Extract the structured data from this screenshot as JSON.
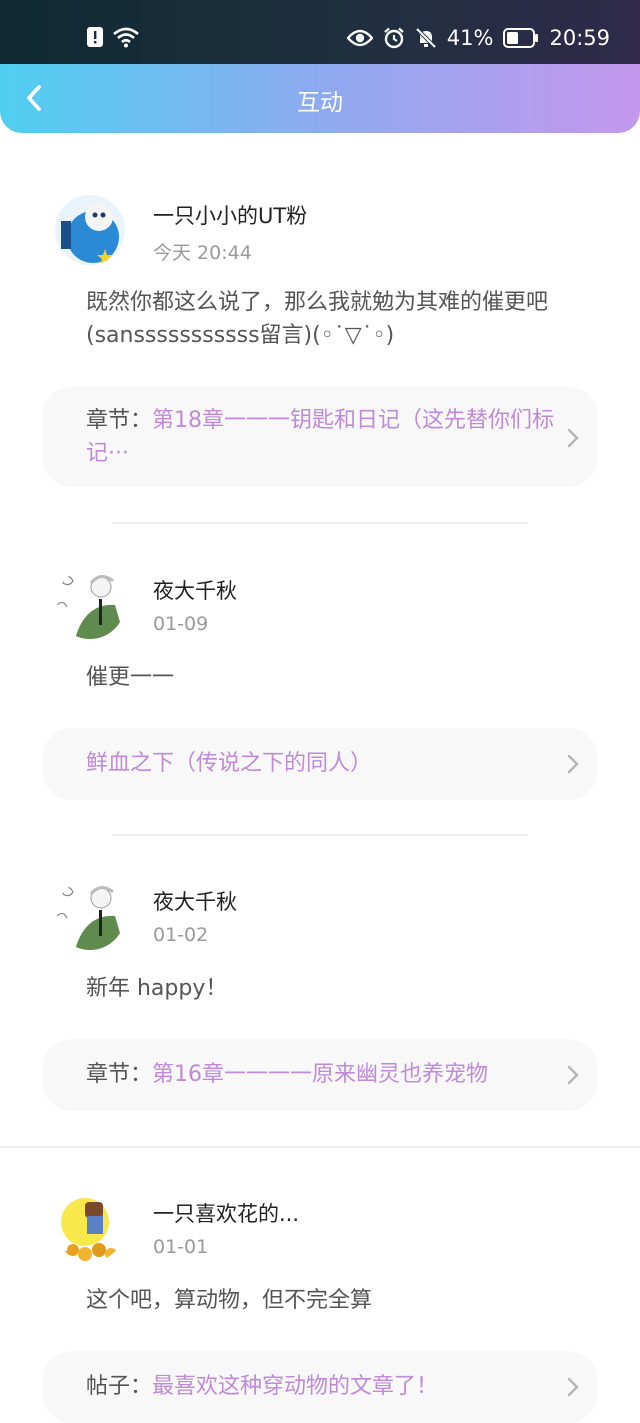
{
  "status_bar": {
    "battery_percent": "41%",
    "time": "20:59",
    "icons": [
      "alert-icon",
      "wifi-icon",
      "eye-icon",
      "alarm-icon",
      "mute-icon",
      "battery-icon"
    ]
  },
  "header": {
    "title": "互动",
    "back_icon": "chevron-left-icon"
  },
  "colors": {
    "link": "#c08ad8",
    "header_start": "#4fcff0",
    "header_end": "#c497ec"
  },
  "comments": [
    {
      "user": "一只小小的UT粉",
      "time": "今天 20:44",
      "message": "既然你都这么说了，那么我就勉为其难的催更吧(sansssssssssss留言)(◦˙▽˙◦)",
      "ref_prefix": "章节：",
      "ref_title": "第18章一一一钥匙和日记（这先替你们标记···"
    },
    {
      "user": "夜大千秋",
      "time": "01-09",
      "message": "催更一一",
      "ref_prefix": "",
      "ref_title": "鲜血之下（传说之下的同人）"
    },
    {
      "user": "夜大千秋",
      "time": "01-02",
      "message": "新年 happy！",
      "ref_prefix": "章节：",
      "ref_title": "第16章一一一一原来幽灵也养宠物"
    },
    {
      "user": "一只喜欢花的...",
      "time": "01-01",
      "message": "这个吧，算动物，但不完全算",
      "ref_prefix": "帖子：",
      "ref_title": "最喜欢这种穿动物的文章了！"
    }
  ]
}
